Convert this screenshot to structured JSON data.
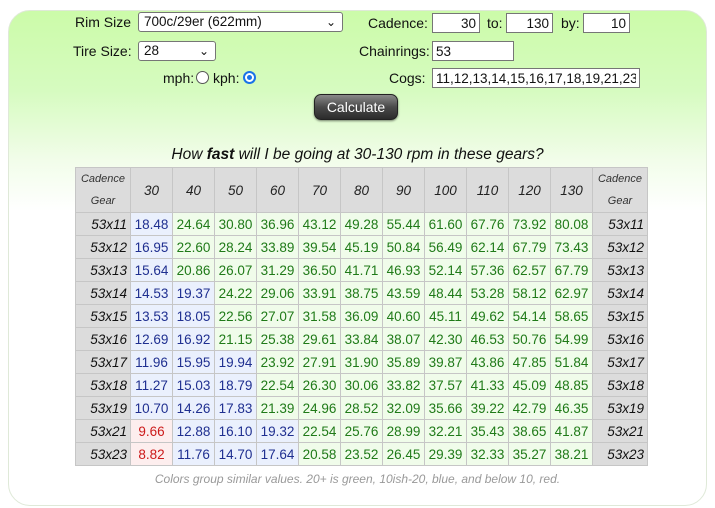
{
  "form": {
    "rim_size_label": "Rim Size",
    "rim_size_value": "700c/29er (622mm)",
    "tire_size_label": "Tire Size:",
    "tire_size_value": "28",
    "units": {
      "mph_label": "mph:",
      "kph_label": "kph:",
      "selected": "kph"
    },
    "cadence_label": "Cadence:",
    "cadence_from": "30",
    "to_label": "to:",
    "cadence_to": "130",
    "by_label": "by:",
    "cadence_by": "10",
    "chainrings_label": "Chainrings:",
    "chainrings_value": "53",
    "cogs_label": "Cogs:",
    "cogs_value": "11,12,13,14,15,16,17,18,19,21,23",
    "calculate_label": "Calculate"
  },
  "table": {
    "heading_prefix": "How ",
    "heading_bold": "fast",
    "heading_suffix": " will I be going at 30-130 rpm in these gears?",
    "corner_top": "Cadence",
    "corner_bottom": "Gear",
    "cadences": [
      "30",
      "40",
      "50",
      "60",
      "70",
      "80",
      "90",
      "100",
      "110",
      "120",
      "130"
    ],
    "rows": [
      {
        "gear": "53x11",
        "values": [
          "18.48",
          "24.64",
          "30.80",
          "36.96",
          "43.12",
          "49.28",
          "55.44",
          "61.60",
          "67.76",
          "73.92",
          "80.08"
        ]
      },
      {
        "gear": "53x12",
        "values": [
          "16.95",
          "22.60",
          "28.24",
          "33.89",
          "39.54",
          "45.19",
          "50.84",
          "56.49",
          "62.14",
          "67.79",
          "73.43"
        ]
      },
      {
        "gear": "53x13",
        "values": [
          "15.64",
          "20.86",
          "26.07",
          "31.29",
          "36.50",
          "41.71",
          "46.93",
          "52.14",
          "57.36",
          "62.57",
          "67.79"
        ]
      },
      {
        "gear": "53x14",
        "values": [
          "14.53",
          "19.37",
          "24.22",
          "29.06",
          "33.91",
          "38.75",
          "43.59",
          "48.44",
          "53.28",
          "58.12",
          "62.97"
        ]
      },
      {
        "gear": "53x15",
        "values": [
          "13.53",
          "18.05",
          "22.56",
          "27.07",
          "31.58",
          "36.09",
          "40.60",
          "45.11",
          "49.62",
          "54.14",
          "58.65"
        ]
      },
      {
        "gear": "53x16",
        "values": [
          "12.69",
          "16.92",
          "21.15",
          "25.38",
          "29.61",
          "33.84",
          "38.07",
          "42.30",
          "46.53",
          "50.76",
          "54.99"
        ]
      },
      {
        "gear": "53x17",
        "values": [
          "11.96",
          "15.95",
          "19.94",
          "23.92",
          "27.91",
          "31.90",
          "35.89",
          "39.87",
          "43.86",
          "47.85",
          "51.84"
        ]
      },
      {
        "gear": "53x18",
        "values": [
          "11.27",
          "15.03",
          "18.79",
          "22.54",
          "26.30",
          "30.06",
          "33.82",
          "37.57",
          "41.33",
          "45.09",
          "48.85"
        ]
      },
      {
        "gear": "53x19",
        "values": [
          "10.70",
          "14.26",
          "17.83",
          "21.39",
          "24.96",
          "28.52",
          "32.09",
          "35.66",
          "39.22",
          "42.79",
          "46.35"
        ]
      },
      {
        "gear": "53x21",
        "values": [
          "9.66",
          "12.88",
          "16.10",
          "19.32",
          "22.54",
          "25.76",
          "28.99",
          "32.21",
          "35.43",
          "38.65",
          "41.87"
        ]
      },
      {
        "gear": "53x23",
        "values": [
          "8.82",
          "11.76",
          "14.70",
          "17.64",
          "20.58",
          "23.52",
          "26.45",
          "29.39",
          "32.33",
          "35.27",
          "38.21"
        ]
      }
    ],
    "note": "Colors group similar values. 20+ is green, 10ish-20, blue, and below 10, red."
  },
  "colors": {
    "green": "#1f7a18",
    "blue": "#1f2f90",
    "red": "#cc1a1a",
    "panel": "#ccfba9"
  }
}
